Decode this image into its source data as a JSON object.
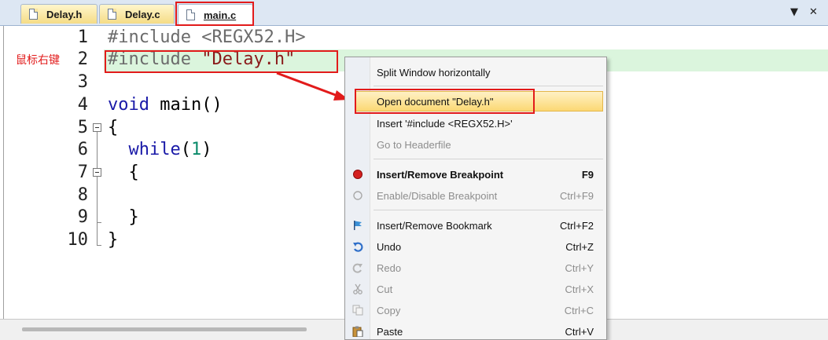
{
  "tabs": [
    {
      "label": "Delay.h",
      "active": false
    },
    {
      "label": "Delay.c",
      "active": false
    },
    {
      "label": "main.c",
      "active": true
    }
  ],
  "tab_controls": {
    "dropdown": "▼",
    "close": "✕"
  },
  "annotation": "鼠标右键",
  "editor": {
    "line_numbers": [
      "1",
      "2",
      "3",
      "4",
      "5",
      "6",
      "7",
      "8",
      "9",
      "10"
    ],
    "lines": {
      "l1_directive": "#include",
      "l1_arg": " <REGX52.H>",
      "l2_directive": "#include",
      "l2_arg": " \"Delay.h\"",
      "l4_kw": "void",
      "l4_rest": " main()",
      "l5": "{",
      "l6_kw": "  while",
      "l6_open": "(",
      "l6_num": "1",
      "l6_close": ")",
      "l7": "  {",
      "l9": "  }",
      "l10": "}"
    }
  },
  "context_menu": {
    "items": [
      {
        "label": "Split Window horizontally",
        "shortcut": "",
        "state": "normal"
      },
      {
        "label": "Open document \"Delay.h\"",
        "shortcut": "",
        "state": "selected"
      },
      {
        "label": "Insert '#include <REGX52.H>'",
        "shortcut": "",
        "state": "normal"
      },
      {
        "label": "Go to Headerfile",
        "shortcut": "",
        "state": "disabled"
      },
      {
        "label": "Insert/Remove Breakpoint",
        "shortcut": "F9",
        "state": "bold",
        "icon": "breakpoint-icon"
      },
      {
        "label": "Enable/Disable Breakpoint",
        "shortcut": "Ctrl+F9",
        "state": "disabled",
        "icon": "breakpoint-toggle-icon"
      },
      {
        "label": "Insert/Remove Bookmark",
        "shortcut": "Ctrl+F2",
        "state": "normal",
        "icon": "bookmark-flag-icon"
      },
      {
        "label": "Undo",
        "shortcut": "Ctrl+Z",
        "state": "normal",
        "icon": "undo-icon"
      },
      {
        "label": "Redo",
        "shortcut": "Ctrl+Y",
        "state": "disabled",
        "icon": "redo-icon"
      },
      {
        "label": "Cut",
        "shortcut": "Ctrl+X",
        "state": "disabled",
        "icon": "scissors-icon"
      },
      {
        "label": "Copy",
        "shortcut": "Ctrl+C",
        "state": "disabled",
        "icon": "copy-icon"
      },
      {
        "label": "Paste",
        "shortcut": "Ctrl+V",
        "state": "normal",
        "icon": "paste-icon"
      }
    ]
  },
  "colors": {
    "highlight_annotation": "#e21b1b",
    "current_line": "#dbf5dd",
    "menu_selected": "#fbd874"
  }
}
